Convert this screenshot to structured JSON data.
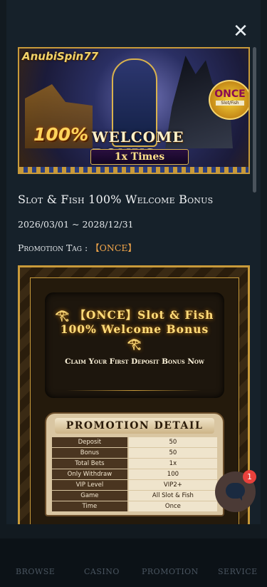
{
  "nav": {
    "items": [
      {
        "label": "BROWSE"
      },
      {
        "label": "CASINO"
      },
      {
        "label": "PROMOTION"
      },
      {
        "label": "SERVICE"
      }
    ]
  },
  "modal": {
    "close_icon": "close-icon",
    "banner": {
      "logo": "AnubiSpin77",
      "percent": "100%",
      "headline": "WELCOME BONUS",
      "times": "1x Times",
      "badge_main": "ONCE",
      "badge_sub": "Slot/Fish"
    },
    "title": "Slot & Fish 100% Welcome Bonus",
    "dates": "2026/03/01 ~ 2028/12/31",
    "tag_label": "Promotion Tag : ",
    "tag_value": "【ONCE】",
    "poster": {
      "headline": "𓂀 【ONCE】Slot & Fish 100% Welcome Bonus 𓂀",
      "subline": "Claim Your First Deposit Bonus Now",
      "detail_title": "PROMOTION DETAIL",
      "rows": [
        {
          "key": "Deposit",
          "value": "50"
        },
        {
          "key": "Bonus",
          "value": "50"
        },
        {
          "key": "Total Bets",
          "value": "1x"
        },
        {
          "key": "Only Withdraw",
          "value": "100"
        },
        {
          "key": "VIP Level",
          "value": "VIP2+"
        },
        {
          "key": "Game",
          "value": "All Slot & Fish"
        },
        {
          "key": "Time",
          "value": "Once"
        }
      ]
    }
  },
  "chat": {
    "icon": "chat-bubble-icon",
    "badge_count": "1"
  }
}
